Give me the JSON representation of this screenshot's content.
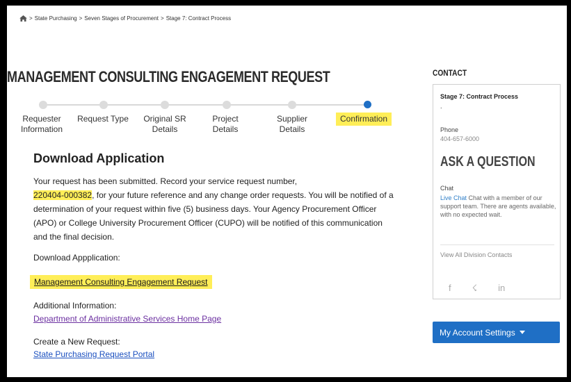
{
  "breadcrumb": {
    "items": [
      "State Purchasing",
      "Seven Stages of Procurement",
      "Stage 7: Contract Process"
    ],
    "separator": ">"
  },
  "page_title": "MANAGEMENT CONSULTING ENGAGEMENT REQUEST",
  "stepper": {
    "steps": [
      {
        "line1": "Requester",
        "line2": "Information"
      },
      {
        "line1": "Request Type",
        "line2": ""
      },
      {
        "line1": "Original SR",
        "line2": "Details"
      },
      {
        "line1": "Project",
        "line2": "Details"
      },
      {
        "line1": "Supplier",
        "line2": "Details"
      },
      {
        "line1": "Confirmation",
        "line2": ""
      }
    ],
    "active_index": 5
  },
  "main": {
    "section_title": "Download Application",
    "para_1": "Your request has been submitted. Record your service request number,",
    "request_number": "220404-000382",
    "para_2": ", for your future reference and any change order requests. You will be notified of a determination of your request within five (5) business days. Your Agency Procurement Officer (APO) or College University Procurement Officer (CUPO) will be notified of this communication and the final decision.",
    "download_label": "Download Appplication:",
    "download_link": "Management Consulting Engagement Request",
    "additional_label": "Additional Information:",
    "additional_link": "Department of Administrative Services Home Page",
    "create_label": "Create a New Request:",
    "create_link": "State Purchasing Request Portal"
  },
  "sidebar": {
    "contact_heading": "CONTACT",
    "stage": "Stage 7: Contract Process",
    "stage_sub": ".",
    "phone_label": "Phone",
    "phone": "404-657-6000",
    "ask_heading": "ASK A QUESTION",
    "chat_label": "Chat",
    "chat_live": "Live Chat",
    "chat_text": " Chat with a member of our support team. There are agents available, with no expected wait.",
    "view_all": "View All Division Contacts",
    "social": [
      "f",
      "☇",
      "in"
    ],
    "account_button": "My Account Settings"
  },
  "colors": {
    "accent": "#1f6fc5",
    "highlight": "#ffee58",
    "link": "#1a4fbf",
    "visited_link": "#6b2fa0"
  }
}
